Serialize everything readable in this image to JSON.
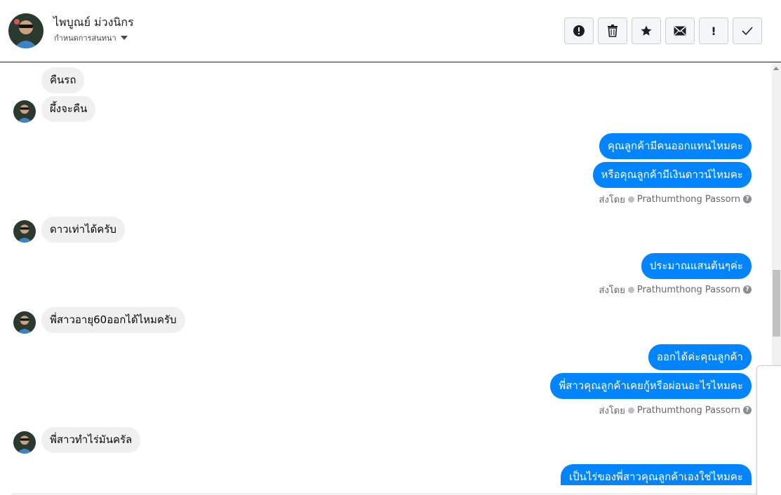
{
  "header": {
    "contact_name": "ไพบูณย์ ม่วงนิกร",
    "convo_setting": "กำหนดการสนทนา"
  },
  "toolbar": {
    "spam_label": "!",
    "buttons": [
      "alert-circle",
      "trash",
      "star",
      "envelope",
      "exclamation",
      "check"
    ]
  },
  "messages": {
    "m1": "คืนรถ",
    "m2": "ผึ้งจะคืน",
    "m3": "คุณลูกค้ามีคนออกแทนไหมคะ",
    "m4": "หรือคุณลูกค้ามีเงินดาวน์ไหมคะ",
    "m5": "ดาวเท่าได้ครับ",
    "m6": "ประมาณแสนต้นๆค่ะ",
    "m7": "พี่สาวอายุ60ออกได้ไหมครับ",
    "m8": "ออกได้ค่ะคุณลูกค้า",
    "m9": "พี่สาวคุณลูกค้าเคยกู้หรือผ่อนอะไรไหมคะ",
    "m10": "พี่สาวทำไร่มันครัล",
    "m11": "เป็นไร่ของพี่สาวคุณลูกค้าเองใช่ไหมคะ"
  },
  "sent_by": {
    "prefix": "ส่งโดย",
    "agent": "Prathumthong Passorn",
    "help": "?"
  },
  "colors": {
    "outgoing": "#0084ff",
    "incoming": "#f0f0f0"
  }
}
